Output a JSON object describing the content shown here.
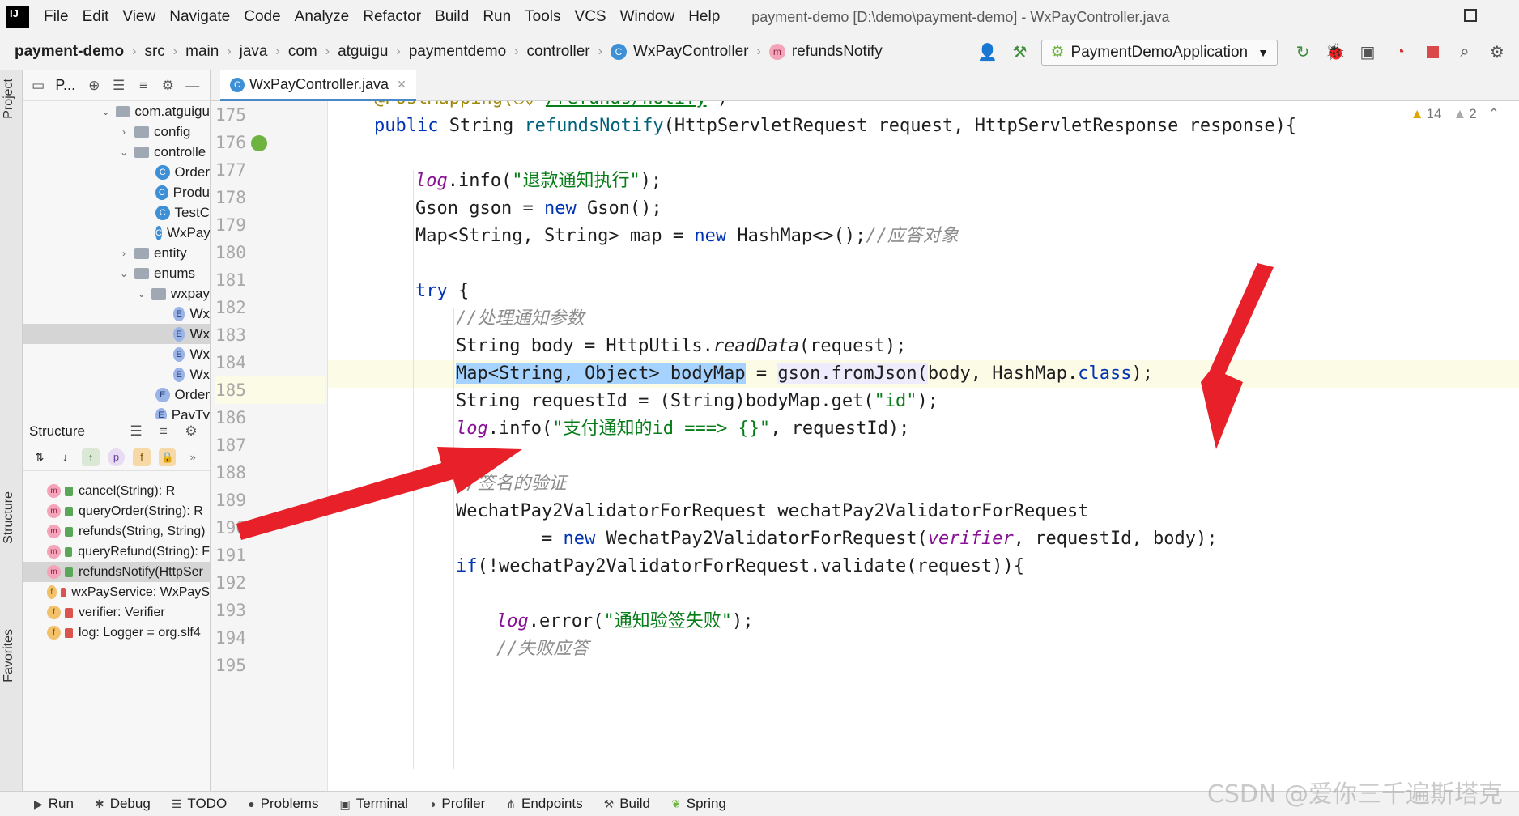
{
  "menubar": {
    "logo": "IJ",
    "items": [
      "File",
      "Edit",
      "View",
      "Navigate",
      "Code",
      "Analyze",
      "Refactor",
      "Build",
      "Run",
      "Tools",
      "VCS",
      "Window",
      "Help"
    ],
    "title": "payment-demo [D:\\demo\\payment-demo] - WxPayController.java"
  },
  "breadcrumb": [
    "payment-demo",
    "src",
    "main",
    "java",
    "com",
    "atguigu",
    "paymentdemo",
    "controller",
    "WxPayController",
    "refundsNotify"
  ],
  "toolbar": {
    "run_config": "PaymentDemoApplication"
  },
  "left_tabs": {
    "project": "Project",
    "structure": "Structure",
    "favorites": "Favorites"
  },
  "project_panel": {
    "title": "P...",
    "tree": [
      {
        "label": "com.atguigu",
        "kind": "folder",
        "arrow": "open"
      },
      {
        "label": "config",
        "kind": "folder",
        "arrow": "closed"
      },
      {
        "label": "controlle",
        "kind": "folder",
        "arrow": "open"
      },
      {
        "label": "Order",
        "kind": "class"
      },
      {
        "label": "Produ",
        "kind": "class"
      },
      {
        "label": "TestC",
        "kind": "class"
      },
      {
        "label": "WxPay",
        "kind": "class"
      },
      {
        "label": "entity",
        "kind": "folder",
        "arrow": "closed"
      },
      {
        "label": "enums",
        "kind": "folder",
        "arrow": "open"
      },
      {
        "label": "wxpay",
        "kind": "folder",
        "arrow": "open"
      },
      {
        "label": "Wx",
        "kind": "enum"
      },
      {
        "label": "Wx",
        "kind": "enum",
        "selected": true
      },
      {
        "label": "Wx",
        "kind": "enum"
      },
      {
        "label": "Wx",
        "kind": "enum"
      },
      {
        "label": "Order",
        "kind": "enum"
      },
      {
        "label": "PayTy",
        "kind": "enum"
      }
    ]
  },
  "structure_panel": {
    "title": "Structure",
    "items": [
      {
        "label": "cancel(String): R",
        "kind": "method"
      },
      {
        "label": "queryOrder(String): R",
        "kind": "method"
      },
      {
        "label": "refunds(String, String)",
        "kind": "method"
      },
      {
        "label": "queryRefund(String): F",
        "kind": "method"
      },
      {
        "label": "refundsNotify(HttpSer",
        "kind": "method",
        "selected": true
      },
      {
        "label": "wxPayService: WxPayS",
        "kind": "field"
      },
      {
        "label": "verifier: Verifier",
        "kind": "field"
      },
      {
        "label": "log: Logger = org.slf4",
        "kind": "field"
      }
    ]
  },
  "editor": {
    "tab": "WxPayController.java",
    "warnings": "14",
    "weak_warnings": "2",
    "line_numbers": [
      "175",
      "176",
      "177",
      "178",
      "179",
      "180",
      "181",
      "182",
      "183",
      "184",
      "185",
      "186",
      "187",
      "188",
      "189",
      "190",
      "191",
      "192",
      "193",
      "194",
      "195"
    ]
  },
  "code": {
    "l175_ann": "@PostMapping(",
    "l175_url": "/refunds/notify",
    "l176_public": "public ",
    "l176_rest": "String ",
    "l176_method": "refundsNotify",
    "l176_params": "(HttpServletRequest request, HttpServletResponse response){",
    "l178_log": "log",
    "l178_info": ".info(",
    "l178_str": "\"退款通知执行\"",
    "l178_end": ");",
    "l179_a": "Gson gson = ",
    "l179_new": "new",
    "l179_b": " Gson();",
    "l180_a": "Map<String, String> map = ",
    "l180_new": "new",
    "l180_b": " HashMap<>();",
    "l180_cmt": "//应答对象",
    "l182_try": "try",
    "l182_brace": " {",
    "l183_cmt": "//处理通知参数",
    "l184_a": "String body = HttpUtils.",
    "l184_static": "readData",
    "l184_b": "(request);",
    "l185_sel": "Map<String, Object> bodyMap",
    "l185_eq": " = ",
    "l185_b": "gson.fromJson(",
    "l185_c": "body, HashMap.",
    "l185_class": "class",
    "l185_end": ");",
    "l186_a": "String requestId = (String)bodyMap.get(",
    "l186_str": "\"id\"",
    "l186_end": ");",
    "l187_log": "log",
    "l187_info": ".info(",
    "l187_str": "\"支付通知的id ===> {}\"",
    "l187_end": ", requestId);",
    "l189_cmt": "//签名的验证",
    "l190": "WechatPay2ValidatorForRequest wechatPay2ValidatorForRequest",
    "l191_eq": "        = ",
    "l191_new": "new",
    "l191_a": " WechatPay2ValidatorForRequest(",
    "l191_fld": "verifier",
    "l191_b": ", requestId, body);",
    "l192_if": "if",
    "l192_a": "(!wechatPay2ValidatorForRequest.validate(request)){",
    "l194_log": "log",
    "l194_err": ".error(",
    "l194_str": "\"通知验签失败\"",
    "l194_end": ");",
    "l195_cmt": "//失败应答"
  },
  "bottombar": [
    "Run",
    "Debug",
    "TODO",
    "Problems",
    "Terminal",
    "Profiler",
    "Endpoints",
    "Build",
    "Spring"
  ],
  "watermark": "CSDN @爱你三千遍斯塔克",
  "colors": {
    "arrow": "#e8202a",
    "selection": "#a6d2ff",
    "keyword": "#0033b3",
    "string": "#067d17"
  }
}
